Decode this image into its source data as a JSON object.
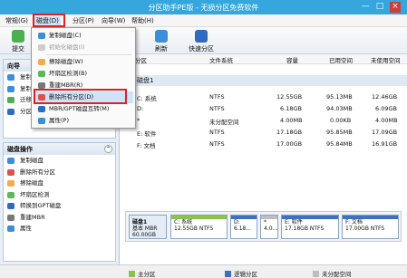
{
  "window": {
    "title": "分区助手PE版 - 无损分区免费软件",
    "min": "—",
    "max": "□",
    "close": "×"
  },
  "menu": [
    "常规(G)",
    "磁盘(D)",
    "分区(P)",
    "向导(W)",
    "帮助(H)"
  ],
  "toolbar": {
    "submit": "提交",
    "refresh": "刷新",
    "quick": "快速分区"
  },
  "left": {
    "wizard_title": "向导",
    "wizard_items": [
      "复制",
      "复制",
      "迁移",
      "分区"
    ],
    "disk_ops_title": "磁盘操作",
    "disk_ops": [
      "复制磁盘",
      "删除所有分区",
      "擦除磁盘",
      "坏扇区检测",
      "转换到GPT磁盘",
      "重建MBR",
      "属性"
    ]
  },
  "table": {
    "headers": [
      "分区",
      "文件系统",
      "容量",
      "已用空间",
      "未使用空间"
    ],
    "disk": "磁盘1",
    "rows": [
      [
        "C: 系统",
        "NTFS",
        "12.55GB",
        "95.13MB",
        "12.46GB"
      ],
      [
        "D:",
        "NTFS",
        "6.18GB",
        "94.03MB",
        "6.09GB"
      ],
      [
        "*",
        "未分配空间",
        "4.00MB",
        "0.00KB",
        "4.00MB"
      ],
      [
        "E: 软件",
        "NTFS",
        "17.18GB",
        "95.85MB",
        "17.09GB"
      ],
      [
        "F: 文档",
        "NTFS",
        "17.00GB",
        "95.84MB",
        "16.91GB"
      ]
    ]
  },
  "diskmap": {
    "name": "磁盘1",
    "type": "基本 MBR",
    "size": "60.00GB",
    "parts": [
      [
        "C: 系统",
        "12.55GB NTFS"
      ],
      [
        "D:",
        "6.18..."
      ],
      [
        "*",
        "4.0..."
      ],
      [
        "E: 软件",
        "17.18GB NTFS"
      ],
      [
        "F: 文档",
        "17.00GB NTFS"
      ]
    ]
  },
  "status": {
    "primary": "主分区",
    "logical": "逻辑分区",
    "unalloc": "未分配空间"
  },
  "dropdown": [
    "复制磁盘(C)",
    "初始化磁盘(I)",
    "擦除磁盘(W)",
    "坏扇区检测(B)",
    "重建MBR(R)",
    "删除所有分区(D)",
    "MBR/GPT磁盘互转(M)",
    "属性(P)"
  ],
  "colors": {
    "title": "#35a7dd",
    "primary": "#8bc34a",
    "logical": "#3f6fbf",
    "unalloc": "#bdbdbd",
    "highlight": "#d22"
  }
}
